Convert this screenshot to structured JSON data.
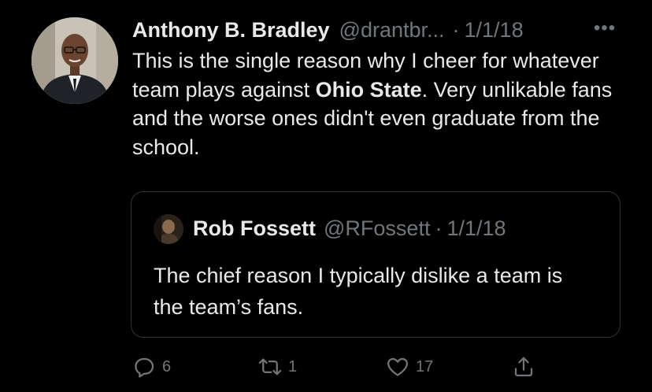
{
  "tweet": {
    "author": {
      "name": "Anthony B. Bradley",
      "handle": "@drantbr...",
      "avatar_icon": "user-avatar"
    },
    "separator": "·",
    "date": "1/1/18",
    "more_icon": "more-dots-icon",
    "text_part1": "This is the single reason why I cheer for whatever team plays against ",
    "text_bold": "Ohio State",
    "text_part2": ". Very unlikable fans and the worse ones didn't even graduate from the school."
  },
  "quote": {
    "author": {
      "name": "Rob Fossett",
      "handle": "@RFossett",
      "avatar_icon": "user-avatar"
    },
    "separator": "·",
    "date": "1/1/18",
    "text": "The chief reason I typically dislike a team is the team’s fans."
  },
  "actions": {
    "reply": {
      "icon": "reply-icon",
      "count": "6"
    },
    "retweet": {
      "icon": "retweet-icon",
      "count": "1"
    },
    "like": {
      "icon": "heart-icon",
      "count": "17"
    },
    "share": {
      "icon": "share-icon",
      "count": ""
    }
  },
  "colors": {
    "background": "#000000",
    "text": "#e7e9ea",
    "secondary": "#71767b",
    "border": "#2f3336"
  }
}
